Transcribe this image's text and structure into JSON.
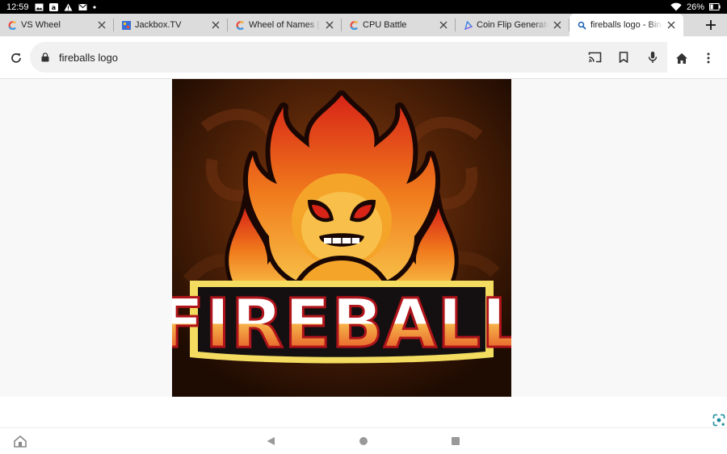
{
  "status_bar": {
    "time": "12:59",
    "battery": "26%",
    "notification_icons": [
      "image-icon",
      "amazon-icon",
      "warning-icon",
      "mail-icon",
      "dot-icon"
    ]
  },
  "tabs": [
    {
      "title": "VS Wheel",
      "favicon": "colorful-c-icon",
      "active": false
    },
    {
      "title": "Jackbox.TV",
      "favicon": "jackbox-icon",
      "active": false
    },
    {
      "title": "Wheel of Names | Ran",
      "favicon": "colorful-c-icon",
      "active": false
    },
    {
      "title": "CPU Battle",
      "favicon": "colorful-c-icon",
      "active": false
    },
    {
      "title": "Coin Flip Generator",
      "favicon": "triangle-icon",
      "active": false
    },
    {
      "title": "fireballs logo - Bing im",
      "favicon": "bing-search-icon",
      "active": true
    }
  ],
  "toolbar": {
    "url": "fireballs logo"
  },
  "content": {
    "logo_text": "FIREBALL"
  },
  "colors": {
    "status_bar": "#000000",
    "tab_strip": "#dcdcdc",
    "active_tab": "#ffffff",
    "omnibox": "#f1f1f1",
    "logo_bg": "#3a1a06",
    "logo_red": "#d72417",
    "logo_orange": "#f29224",
    "logo_yellow": "#f3dc60"
  }
}
